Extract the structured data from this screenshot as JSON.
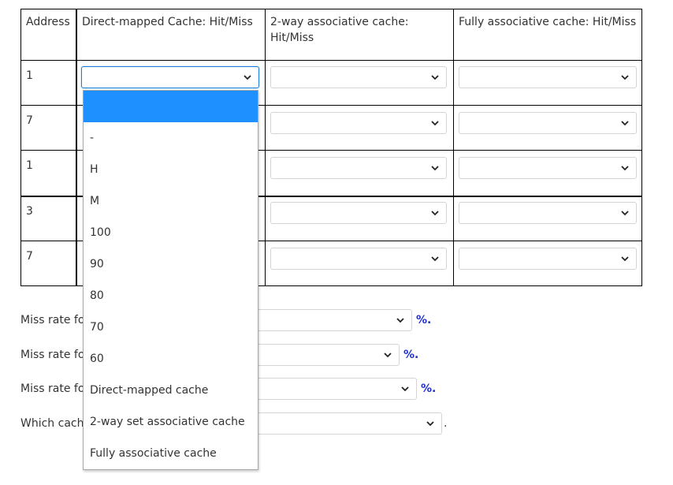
{
  "table": {
    "headers": {
      "address": "Address",
      "direct_mapped": "Direct-mapped Cache: Hit/Miss",
      "two_way": "2-way associative cache: Hit/Miss",
      "fully": "Fully associative cache: Hit/Miss"
    },
    "rows": [
      {
        "address": "1"
      },
      {
        "address": "7"
      },
      {
        "address": "1"
      },
      {
        "address": "3"
      },
      {
        "address": "7"
      }
    ]
  },
  "questions": [
    {
      "label": "Miss rate fo",
      "suffix": "%."
    },
    {
      "label": "Miss rate fo",
      "suffix": "%."
    },
    {
      "label": "Miss rate fo",
      "suffix": "%."
    },
    {
      "label": "Which cach",
      "suffix": "."
    }
  ],
  "dropdown": {
    "options": [
      "",
      "-",
      "H",
      "M",
      "100",
      "90",
      "80",
      "70",
      "60",
      "Direct-mapped cache",
      "2-way set associative cache",
      "Fully associative cache"
    ],
    "highlighted_index": 0,
    "highlight_color": "#1e90ff"
  },
  "colors": {
    "focus_border": "#1f7fd6",
    "percent_text": "#1e2fd0"
  },
  "icons": {
    "select_arrow": "chevron-down-icon"
  }
}
